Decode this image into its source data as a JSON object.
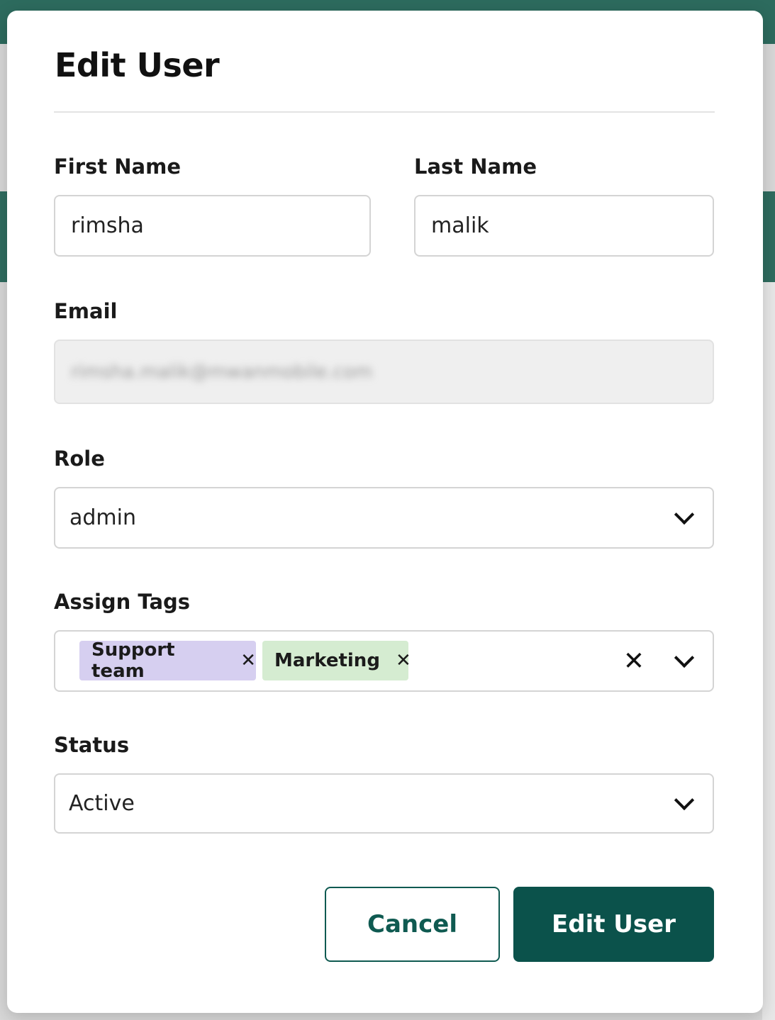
{
  "modal": {
    "title": "Edit User"
  },
  "form": {
    "first_name": {
      "label": "First Name",
      "value": "rimsha"
    },
    "last_name": {
      "label": "Last Name",
      "value": "malik"
    },
    "email": {
      "label": "Email",
      "value": "rimsha.malik@mwanmobile.com"
    },
    "role": {
      "label": "Role",
      "value": "admin"
    },
    "tags": {
      "label": "Assign Tags",
      "items": [
        {
          "label": "Support team",
          "remove": "✕",
          "color": "#d6cff0"
        },
        {
          "label": "Marketing",
          "remove": "✕",
          "color": "#d5ecd1"
        }
      ],
      "clear": "✕"
    },
    "status": {
      "label": "Status",
      "value": "Active"
    }
  },
  "actions": {
    "cancel_label": "Cancel",
    "submit_label": "Edit User"
  },
  "colors": {
    "primary": "#0b524b",
    "backdrop_header": "#2d6b5e"
  },
  "icons": {
    "dropdown": "chevron-down-icon",
    "remove": "close-icon"
  }
}
